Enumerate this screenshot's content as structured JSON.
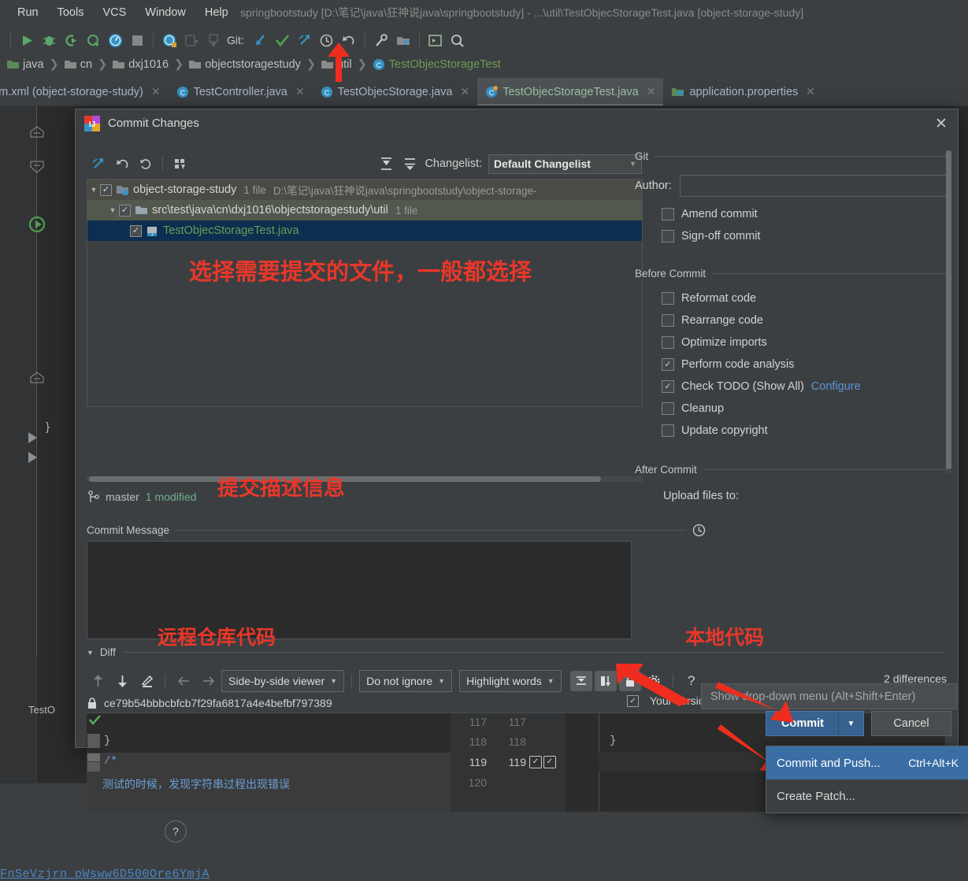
{
  "ide": {
    "menu": [
      "Run",
      "Tools",
      "VCS",
      "Window",
      "Help"
    ],
    "title": "springbootstudy [D:\\笔记\\java\\狂神说java\\springbootstudy] - ...\\util\\TestObjecStorageTest.java [object-storage-study]",
    "git_label": "Git:",
    "breadcrumbs": [
      "java",
      "cn",
      "dxj1016",
      "objectstoragestudy",
      "util",
      "TestObjecStorageTest"
    ],
    "tabs": [
      {
        "label": "pom.xml (object-storage-study)",
        "active": false
      },
      {
        "label": "TestController.java",
        "active": false
      },
      {
        "label": "TestObjecStorage.java",
        "active": false
      },
      {
        "label": "TestObjecStorageTest.java",
        "active": true
      },
      {
        "label": "application.properties",
        "active": false
      }
    ],
    "editor_brace": "}",
    "code_link": "FnSeVzjrn_pWsww6D500Ore6YmjA",
    "side_tab": "TestO"
  },
  "dialog": {
    "title": "Commit Changes",
    "changelist_label": "Changelist:",
    "changelist_value": "Default Changelist",
    "tree": [
      {
        "name": "object-storage-study",
        "meta": "1 file",
        "path": "D:\\笔记\\java\\狂神说java\\springbootstudy\\object-storage-",
        "checked": true,
        "level": 0
      },
      {
        "name": "src\\test\\java\\cn\\dxj1016\\objectstoragestudy\\util",
        "meta": "1 file",
        "path": "",
        "checked": true,
        "level": 1
      },
      {
        "name": "TestObjecStorageTest.java",
        "meta": "",
        "path": "",
        "checked": true,
        "level": 2
      }
    ],
    "branch": "master",
    "modified": "1 modified",
    "commit_message_label": "Commit Message",
    "commit_message_value": "",
    "git_group": "Git",
    "author_label": "Author:",
    "author_value": "",
    "git_options": [
      {
        "label": "Amend commit",
        "checked": false
      },
      {
        "label": "Sign-off commit",
        "checked": false
      }
    ],
    "before_commit_group": "Before Commit",
    "before_commit_options": [
      {
        "label": "Reformat code",
        "checked": false
      },
      {
        "label": "Rearrange code",
        "checked": false
      },
      {
        "label": "Optimize imports",
        "checked": false
      },
      {
        "label": "Perform code analysis",
        "checked": true
      },
      {
        "label": "Check TODO (Show All)",
        "checked": true,
        "link": "Configure"
      },
      {
        "label": "Cleanup",
        "checked": false
      },
      {
        "label": "Update copyright",
        "checked": false
      }
    ],
    "after_commit_group": "After Commit",
    "upload_files_to": "Upload files to:",
    "diff": {
      "section_label": "Diff",
      "viewer_mode": "Side-by-side viewer",
      "ignore_mode": "Do not ignore",
      "highlight_mode": "Highlight words",
      "differences": "2 differences",
      "revision_hash": "ce79b54bbbcbfcb7f29fa6817a4e4befbf797389",
      "your_version": "Your version",
      "left_lines": [
        {
          "num": "117",
          "text": ""
        },
        {
          "num": "118",
          "text": "}"
        },
        {
          "num": "119",
          "text": "/*"
        },
        {
          "num": "120",
          "text": "测试的时候，发现字符串过程出现错误"
        }
      ],
      "right_lines": [
        {
          "num": "117",
          "text": ""
        },
        {
          "num": "118",
          "text": "}"
        },
        {
          "num": "119",
          "text": ""
        }
      ]
    },
    "help": "?",
    "tooltip": "Show drop-down menu (Alt+Shift+Enter)",
    "commit_button": "Commit",
    "cancel_button": "Cancel",
    "menu_items": [
      {
        "label": "Commit and Push...",
        "shortcut": "Ctrl+Alt+K",
        "selected": true
      },
      {
        "label": "Create Patch...",
        "shortcut": "",
        "selected": false
      }
    ]
  },
  "annotations": {
    "select_files": "选择需要提交的文件，一般都选择",
    "commit_desc": "提交描述信息",
    "remote_code": "远程仓库代码",
    "local_code": "本地代码"
  },
  "colors": {
    "accent": "#37618e",
    "annotation": "#e8372a",
    "link": "#5b93d6",
    "selection": "#0d2f4f"
  }
}
